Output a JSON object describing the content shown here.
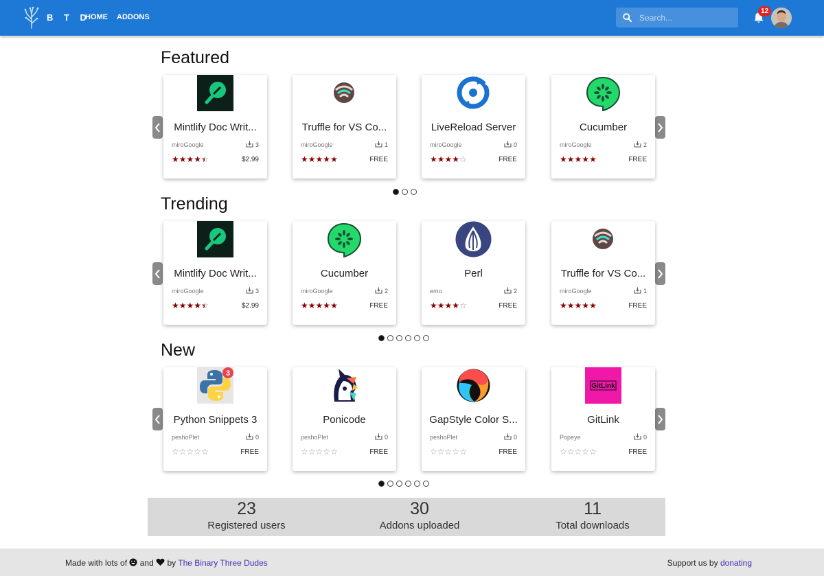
{
  "header": {
    "brand": "B T D",
    "nav": [
      "HOME",
      "ADDONS"
    ],
    "search_placeholder": "Search...",
    "notifications_count": "12",
    "accent_color": "#1e78d6"
  },
  "sections": [
    {
      "title": "Featured",
      "dots": 3,
      "active_dot": 0,
      "cards": [
        {
          "name": "Mintlify Doc Writ...",
          "author": "miroGoogle",
          "downloads": "3",
          "rating": 4.5,
          "price": "$2.99",
          "icon": "mintlify-icon"
        },
        {
          "name": "Truffle for VS Co...",
          "author": "miroGoogle",
          "downloads": "1",
          "rating": 5,
          "price": "FREE",
          "icon": "truffle-icon"
        },
        {
          "name": "LiveReload Server",
          "author": "miroGoogle",
          "downloads": "0",
          "rating": 4,
          "price": "FREE",
          "icon": "livereload-icon"
        },
        {
          "name": "Cucumber",
          "author": "miroGoogle",
          "downloads": "2",
          "rating": 5,
          "price": "FREE",
          "icon": "cucumber-icon"
        }
      ]
    },
    {
      "title": "Trending",
      "dots": 6,
      "active_dot": 0,
      "cards": [
        {
          "name": "Mintlify Doc Writ...",
          "author": "miroGoogle",
          "downloads": "3",
          "rating": 4.5,
          "price": "$2.99",
          "icon": "mintlify-icon"
        },
        {
          "name": "Cucumber",
          "author": "miroGoogle",
          "downloads": "2",
          "rating": 5,
          "price": "FREE",
          "icon": "cucumber-icon"
        },
        {
          "name": "Perl",
          "author": "emo",
          "downloads": "2",
          "rating": 4,
          "price": "FREE",
          "icon": "perl-icon"
        },
        {
          "name": "Truffle for VS Co...",
          "author": "miroGoogle",
          "downloads": "1",
          "rating": 5,
          "price": "FREE",
          "icon": "truffle-icon"
        }
      ]
    },
    {
      "title": "New",
      "dots": 6,
      "active_dot": 0,
      "cards": [
        {
          "name": "Python Snippets 3",
          "author": "peshoPlet",
          "downloads": "0",
          "rating": 0,
          "price": "FREE",
          "icon": "python-snippets-icon"
        },
        {
          "name": "Ponicode",
          "author": "peshoPlet",
          "downloads": "0",
          "rating": 0,
          "price": "FREE",
          "icon": "ponicode-icon"
        },
        {
          "name": "GapStyle Color S...",
          "author": "peshoPlet",
          "downloads": "0",
          "rating": 0,
          "price": "FREE",
          "icon": "gapstyle-icon"
        },
        {
          "name": "GitLink",
          "author": "Popeye",
          "downloads": "0",
          "rating": 0,
          "price": "FREE",
          "icon": "gitlink-icon"
        }
      ]
    }
  ],
  "icon_text": {
    "python_badge": "3",
    "gitlink_logo": "GitLink"
  },
  "stats": [
    {
      "number": "23",
      "label": "Registered users"
    },
    {
      "number": "30",
      "label": "Addons uploaded"
    },
    {
      "number": "11",
      "label": "Total downloads"
    }
  ],
  "footer": {
    "made_with": "Made with lots of",
    "and": "and",
    "by": "by",
    "team": "The Binary Three Dudes",
    "support": "Support us by",
    "donate": "donating"
  },
  "colors": {
    "star_filled": "#8b0000",
    "star_empty": "#9a9a9a",
    "link": "#3d2fb2"
  }
}
